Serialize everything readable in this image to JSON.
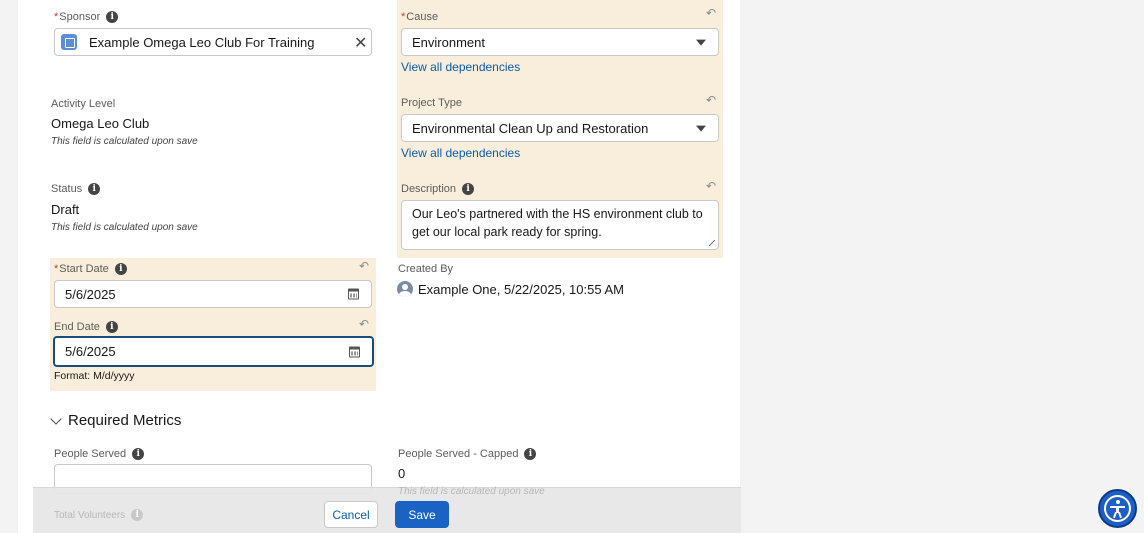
{
  "left": {
    "sponsor": {
      "label": "Sponsor",
      "value": "Example Omega Leo Club For Training"
    },
    "activity_level": {
      "label": "Activity Level",
      "value": "Omega Leo Club",
      "note": "This field is calculated upon save"
    },
    "status": {
      "label": "Status",
      "value": "Draft",
      "note": "This field is calculated upon save"
    },
    "start_date": {
      "label": "Start Date",
      "value": "5/6/2025"
    },
    "end_date": {
      "label": "End Date",
      "value": "5/6/2025",
      "format_hint": "Format: M/d/yyyy"
    }
  },
  "right": {
    "cause": {
      "label": "Cause",
      "value": "Environment",
      "link": "View all dependencies"
    },
    "project_type": {
      "label": "Project Type",
      "value": "Environmental Clean Up and Restoration",
      "link": "View all dependencies"
    },
    "description": {
      "label": "Description",
      "value": "Our Leo's partnered with the HS environment club to get our local park ready for spring."
    },
    "created_by": {
      "label": "Created By",
      "value": "Example One, 5/22/2025, 10:55 AM"
    }
  },
  "metrics": {
    "section_title": "Required Metrics",
    "people_served": {
      "label": "People Served",
      "value": ""
    },
    "people_served_capped": {
      "label": "People Served - Capped",
      "value": "0",
      "note": "This field is calculated upon save"
    },
    "total_volunteers": {
      "label": "Total Volunteers"
    }
  },
  "footer": {
    "cancel": "Cancel",
    "save": "Save"
  },
  "colors": {
    "highlight": "#f9eedb",
    "link": "#0b5cab",
    "save": "#1b62c5",
    "accessibility": "#1e5fc7"
  },
  "icons": [
    "info-icon",
    "account-icon",
    "clear-icon",
    "dropdown-caret-icon",
    "calendar-icon",
    "undo-icon",
    "user-avatar-icon",
    "chevron-down-icon",
    "resize-grip-icon",
    "accessibility-icon"
  ]
}
